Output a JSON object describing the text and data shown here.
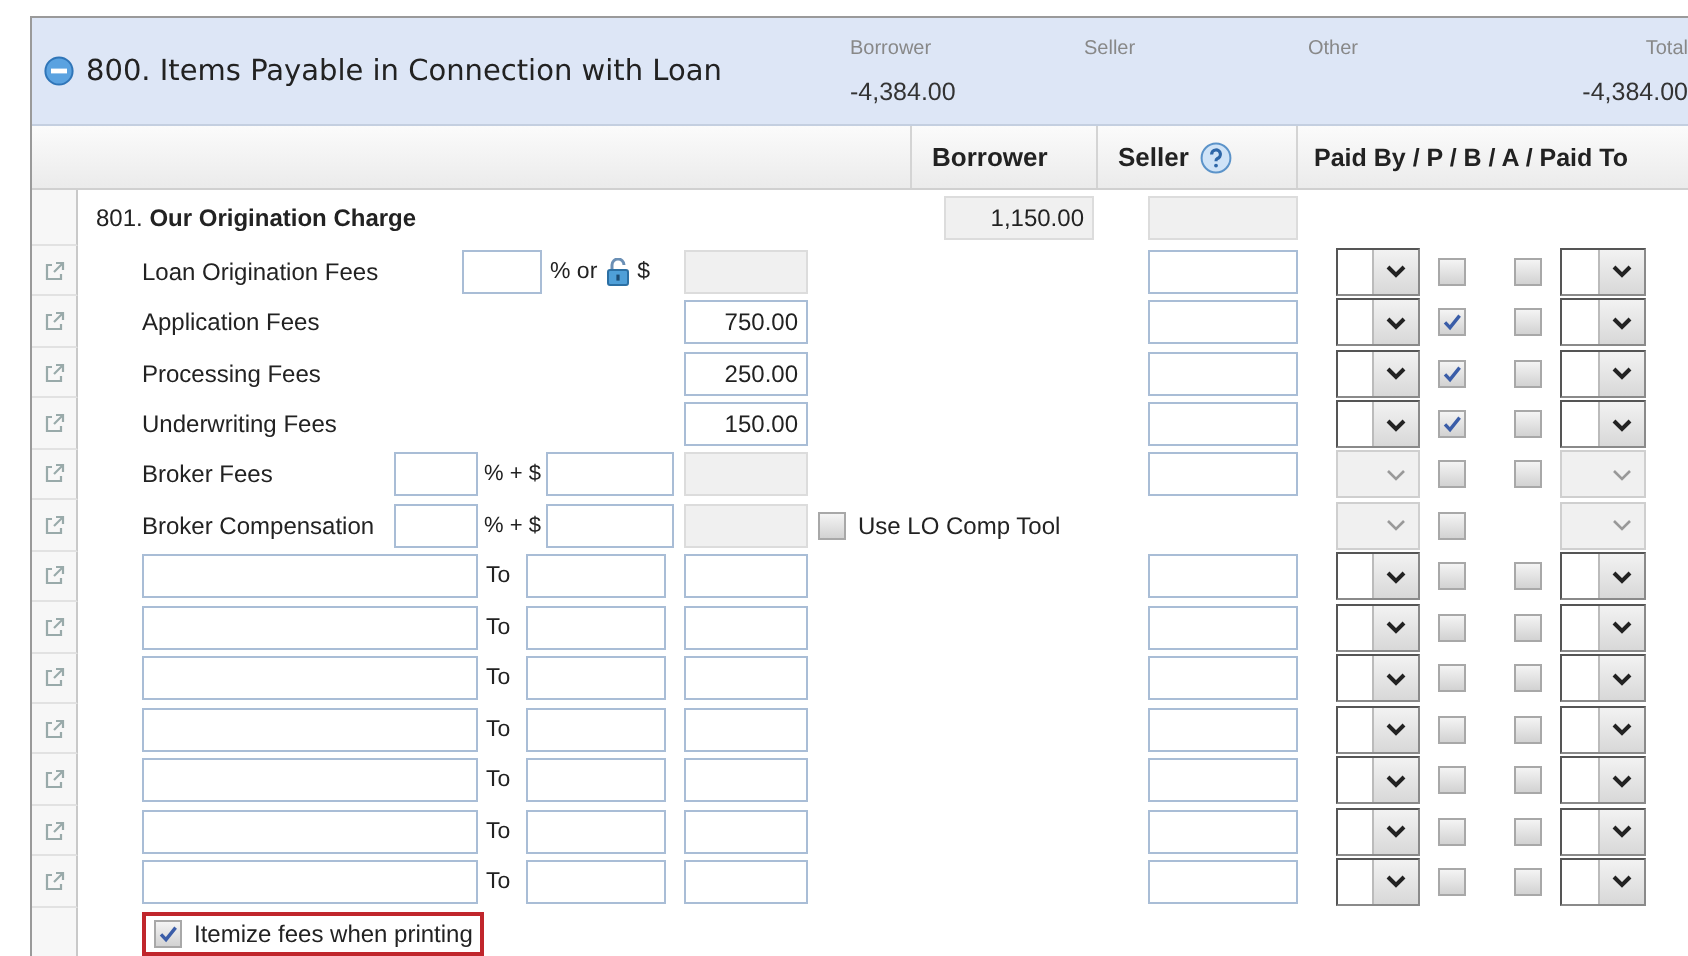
{
  "section": {
    "title": "800. Items Payable in Connection with Loan",
    "expanded": true,
    "summary": [
      {
        "label": "Borrower",
        "value": "-4,384.00"
      },
      {
        "label": "Seller"
      },
      {
        "label": "Other"
      },
      {
        "label": "Total",
        "value": "-4,384.00"
      }
    ]
  },
  "columns": [
    {
      "label": "Borrower",
      "help": false
    },
    {
      "label": "Seller",
      "help": true
    },
    {
      "label": "Paid By  / P / B / A / Paid To",
      "help": false
    }
  ],
  "line": {
    "number": "801.",
    "label": "Our Origination Charge",
    "borrower": "1,150.00",
    "seller_disabled": true
  },
  "rows": [
    {
      "kind": "percent",
      "label": "Loan Origination Fees",
      "connector": "% or",
      "currency": "$",
      "amount_disabled": true,
      "seller_field": true,
      "paid_by_enabled": true,
      "p_checked": false,
      "b_checkbox": true,
      "paid_to_enabled": true
    },
    {
      "kind": "amount",
      "label": "Application Fees",
      "amount": "750.00",
      "amount_disabled": false,
      "seller_field": true,
      "paid_by_enabled": true,
      "p_checked": true,
      "b_checkbox": true,
      "paid_to_enabled": true
    },
    {
      "kind": "amount",
      "label": "Processing Fees",
      "amount": "250.00",
      "amount_disabled": false,
      "seller_field": true,
      "paid_by_enabled": true,
      "p_checked": true,
      "b_checkbox": true,
      "paid_to_enabled": true
    },
    {
      "kind": "amount",
      "label": "Underwriting Fees",
      "amount": "150.00",
      "amount_disabled": false,
      "seller_field": true,
      "paid_by_enabled": true,
      "p_checked": true,
      "b_checkbox": true,
      "paid_to_enabled": true
    },
    {
      "kind": "broker",
      "label": "Broker Fees",
      "connector": "% + $",
      "amount_disabled": true,
      "seller_field": true,
      "paid_by_enabled": false,
      "p_checked": false,
      "b_checkbox": true,
      "paid_to_enabled": false
    },
    {
      "kind": "broker",
      "label": "Broker Compensation",
      "connector": "% + $",
      "amount_disabled": true,
      "seller_field": false,
      "paid_by_enabled": false,
      "p_checked": false,
      "b_checkbox": false,
      "paid_to_enabled": false,
      "lo_comp_tool": {
        "label": "Use LO Comp Tool",
        "checked": false
      }
    },
    {
      "kind": "custom",
      "connector": "To",
      "amount_disabled": false,
      "seller_field": true,
      "paid_by_enabled": true,
      "p_checked": false,
      "b_checkbox": true,
      "paid_to_enabled": true
    },
    {
      "kind": "custom",
      "connector": "To",
      "amount_disabled": false,
      "seller_field": true,
      "paid_by_enabled": true,
      "p_checked": false,
      "b_checkbox": true,
      "paid_to_enabled": true
    },
    {
      "kind": "custom",
      "connector": "To",
      "amount_disabled": false,
      "seller_field": true,
      "paid_by_enabled": true,
      "p_checked": false,
      "b_checkbox": true,
      "paid_to_enabled": true
    },
    {
      "kind": "custom",
      "connector": "To",
      "amount_disabled": false,
      "seller_field": true,
      "paid_by_enabled": true,
      "p_checked": false,
      "b_checkbox": true,
      "paid_to_enabled": true
    },
    {
      "kind": "custom",
      "connector": "To",
      "amount_disabled": false,
      "seller_field": true,
      "paid_by_enabled": true,
      "p_checked": false,
      "b_checkbox": true,
      "paid_to_enabled": true
    },
    {
      "kind": "custom",
      "connector": "To",
      "amount_disabled": false,
      "seller_field": true,
      "paid_by_enabled": true,
      "p_checked": false,
      "b_checkbox": true,
      "paid_to_enabled": true
    },
    {
      "kind": "custom",
      "connector": "To",
      "amount_disabled": false,
      "seller_field": true,
      "paid_by_enabled": true,
      "p_checked": false,
      "b_checkbox": true,
      "paid_to_enabled": true
    }
  ],
  "itemize": {
    "label": "Itemize fees when printing",
    "checked": true
  }
}
